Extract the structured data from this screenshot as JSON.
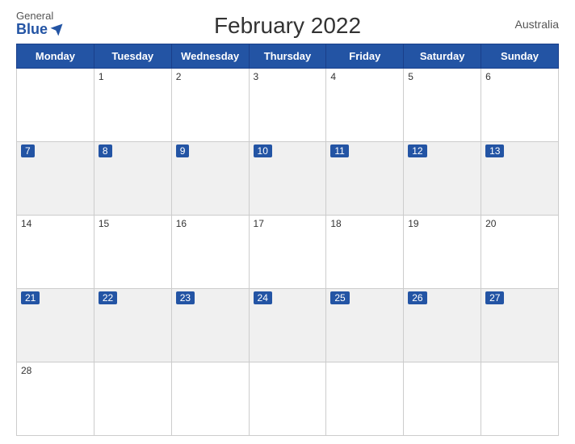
{
  "header": {
    "logo": {
      "general": "General",
      "blue": "Blue"
    },
    "title": "February 2022",
    "country": "Australia"
  },
  "calendar": {
    "weekdays": [
      "Monday",
      "Tuesday",
      "Wednesday",
      "Thursday",
      "Friday",
      "Saturday",
      "Sunday"
    ],
    "weeks": [
      {
        "blueHeader": false,
        "days": [
          {
            "num": "",
            "inMonth": false
          },
          {
            "num": "1",
            "inMonth": true
          },
          {
            "num": "2",
            "inMonth": true
          },
          {
            "num": "3",
            "inMonth": true
          },
          {
            "num": "4",
            "inMonth": true
          },
          {
            "num": "5",
            "inMonth": true
          },
          {
            "num": "6",
            "inMonth": true
          }
        ]
      },
      {
        "blueHeader": true,
        "days": [
          {
            "num": "7",
            "inMonth": true
          },
          {
            "num": "8",
            "inMonth": true
          },
          {
            "num": "9",
            "inMonth": true
          },
          {
            "num": "10",
            "inMonth": true
          },
          {
            "num": "11",
            "inMonth": true
          },
          {
            "num": "12",
            "inMonth": true
          },
          {
            "num": "13",
            "inMonth": true
          }
        ]
      },
      {
        "blueHeader": false,
        "days": [
          {
            "num": "14",
            "inMonth": true
          },
          {
            "num": "15",
            "inMonth": true
          },
          {
            "num": "16",
            "inMonth": true
          },
          {
            "num": "17",
            "inMonth": true
          },
          {
            "num": "18",
            "inMonth": true
          },
          {
            "num": "19",
            "inMonth": true
          },
          {
            "num": "20",
            "inMonth": true
          }
        ]
      },
      {
        "blueHeader": true,
        "days": [
          {
            "num": "21",
            "inMonth": true
          },
          {
            "num": "22",
            "inMonth": true
          },
          {
            "num": "23",
            "inMonth": true
          },
          {
            "num": "24",
            "inMonth": true
          },
          {
            "num": "25",
            "inMonth": true
          },
          {
            "num": "26",
            "inMonth": true
          },
          {
            "num": "27",
            "inMonth": true
          }
        ]
      },
      {
        "blueHeader": false,
        "days": [
          {
            "num": "28",
            "inMonth": true
          },
          {
            "num": "",
            "inMonth": false
          },
          {
            "num": "",
            "inMonth": false
          },
          {
            "num": "",
            "inMonth": false
          },
          {
            "num": "",
            "inMonth": false
          },
          {
            "num": "",
            "inMonth": false
          },
          {
            "num": "",
            "inMonth": false
          }
        ]
      }
    ]
  }
}
